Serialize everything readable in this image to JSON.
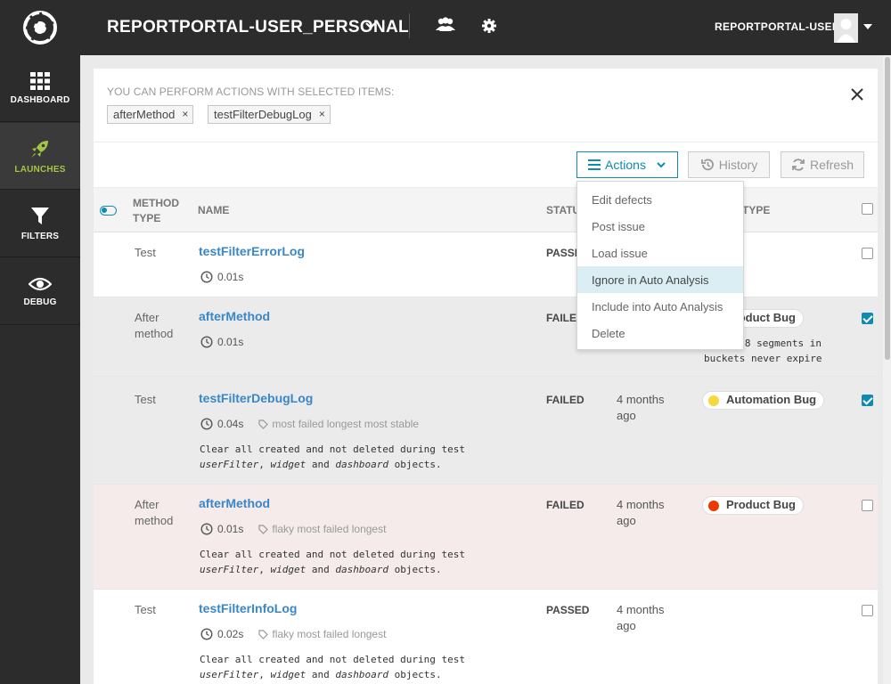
{
  "header": {
    "project_title": "REPORTPORTAL-USER_PERSONAL",
    "user_name": "REPORTPORTAL-USER"
  },
  "sidebar": {
    "items": [
      {
        "label": "DASHBOARD",
        "icon": "grid-icon"
      },
      {
        "label": "LAUNCHES",
        "icon": "rocket-icon",
        "active": true
      },
      {
        "label": "FILTERS",
        "icon": "filter-icon"
      },
      {
        "label": "DEBUG",
        "icon": "eye-icon"
      }
    ]
  },
  "selection": {
    "caption": "YOU CAN PERFORM ACTIONS WITH SELECTED ITEMS:",
    "chips": [
      "afterMethod",
      "testFilterDebugLog"
    ],
    "chip_close": "×"
  },
  "toolbar": {
    "actions_label": "Actions",
    "history_label": "History",
    "refresh_label": "Refresh"
  },
  "table": {
    "headers": {
      "method_type_1": "METHOD",
      "method_type_2": "TYPE",
      "name": "NAME",
      "status": "STATUS",
      "defect_type": "TYPE"
    },
    "rows": [
      {
        "method_type": "Test",
        "name": "testFilterErrorLog",
        "duration": "0.01s",
        "status": "PASSED",
        "checked": false
      },
      {
        "method_type_1": "After",
        "method_type_2": "method",
        "name": "afterMethod",
        "duration": "0.01s",
        "status": "FAILED",
        "defect": "Product Bug",
        "defect_text_1": "...38 segments in",
        "defect_text_2": "buckets never expire",
        "checked": true
      },
      {
        "method_type": "Test",
        "name": "testFilterDebugLog",
        "duration": "0.04s",
        "tags": "most failed longest most stable",
        "desc_1": "Clear all created and not deleted during test",
        "desc_2_a": "userFilter",
        "desc_2_b": ", ",
        "desc_2_c": "widget",
        "desc_2_d": " and ",
        "desc_2_e": "dashboard",
        "desc_2_f": " objects.",
        "status": "FAILED",
        "start_1": "4 months",
        "start_2": "ago",
        "defect": "Automation Bug",
        "checked": true
      },
      {
        "method_type_1": "After",
        "method_type_2": "method",
        "name": "afterMethod",
        "duration": "0.01s",
        "tags": "flaky most failed longest",
        "desc_1": "Clear all created and not deleted during test",
        "desc_2_a": "userFilter",
        "desc_2_b": ", ",
        "desc_2_c": "widget",
        "desc_2_d": " and ",
        "desc_2_e": "dashboard",
        "desc_2_f": " objects.",
        "status": "FAILED",
        "start_1": "4 months",
        "start_2": "ago",
        "defect": "Product Bug",
        "checked": false
      },
      {
        "method_type": "Test",
        "name": "testFilterInfoLog",
        "duration": "0.02s",
        "tags": "flaky most failed longest",
        "desc_1": "Clear all created and not deleted during test",
        "desc_2_a": "userFilter",
        "desc_2_b": ", ",
        "desc_2_c": "widget",
        "desc_2_d": " and ",
        "desc_2_e": "dashboard",
        "desc_2_f": " objects.",
        "status": "PASSED",
        "start_1": "4 months",
        "start_2": "ago",
        "checked": false
      }
    ]
  },
  "actions_menu": {
    "items": [
      "Edit defects",
      "Post issue",
      "Load issue",
      "Ignore in Auto Analysis",
      "Include into Auto Analysis",
      "Delete"
    ],
    "highlighted": "Ignore in Auto Analysis"
  },
  "colors": {
    "accent": "#0f8ab3",
    "link": "#3a87c8",
    "product_bug": "#ec3900",
    "automation_bug": "#f7d63e",
    "active_nav": "#a3c644",
    "header_bg": "#2c2c2c"
  }
}
